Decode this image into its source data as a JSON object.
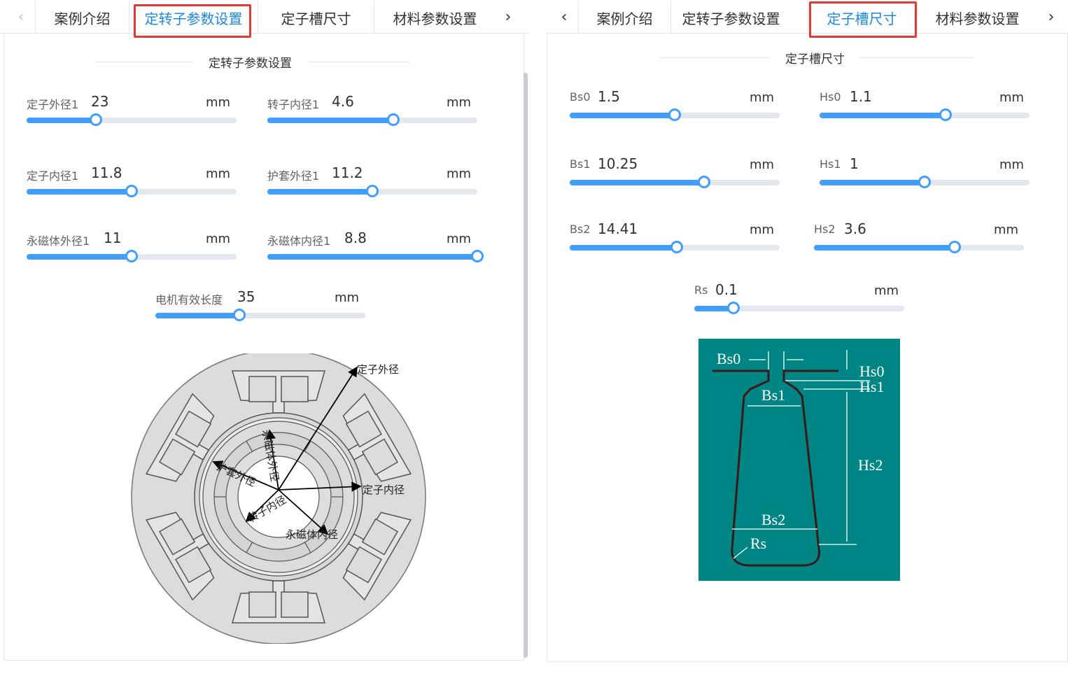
{
  "colors": {
    "accent": "#409eff",
    "highlight": "#e53935",
    "slot_bg": "#008585"
  },
  "left": {
    "tabs": [
      {
        "label": "案例介绍"
      },
      {
        "label": "定转子参数设置"
      },
      {
        "label": "定子槽尺寸"
      },
      {
        "label": "材料参数设置"
      }
    ],
    "active_tab": "定转子参数设置",
    "section_title": "定转子参数设置",
    "params": [
      {
        "label": "定子外径1",
        "value": "23",
        "unit": "mm",
        "fraction": 0.33
      },
      {
        "label": "转子内径1",
        "value": "4.6",
        "unit": "mm",
        "fraction": 0.6
      },
      {
        "label": "定子内径1",
        "value": "11.8",
        "unit": "mm",
        "fraction": 0.5
      },
      {
        "label": "护套外径1",
        "value": "11.2",
        "unit": "mm",
        "fraction": 0.5
      },
      {
        "label": "永磁体外径1",
        "value": "11",
        "unit": "mm",
        "fraction": 0.5
      },
      {
        "label": "永磁体内径1",
        "value": "8.8",
        "unit": "mm",
        "fraction": 1.0
      },
      {
        "label": "电机有效长度",
        "value": "35",
        "unit": "mm",
        "fraction": 0.4
      }
    ],
    "diagram_labels": {
      "stator_outer": "定子外径",
      "magnet_outer": "永磁体外径",
      "sleeve_outer": "护套外径",
      "stator_inner": "定子内径",
      "rotor_inner": "转子内径",
      "magnet_inner": "永磁体内径"
    }
  },
  "right": {
    "tabs": [
      {
        "label": "案例介绍"
      },
      {
        "label": "定转子参数设置"
      },
      {
        "label": "定子槽尺寸"
      },
      {
        "label": "材料参数设置"
      }
    ],
    "active_tab": "定子槽尺寸",
    "section_title": "定子槽尺寸",
    "params": [
      {
        "label": "Bs0",
        "value": "1.5",
        "unit": "mm",
        "fraction": 0.5
      },
      {
        "label": "Hs0",
        "value": "1.1",
        "unit": "mm",
        "fraction": 0.6
      },
      {
        "label": "Bs1",
        "value": "10.25",
        "unit": "mm",
        "fraction": 0.64
      },
      {
        "label": "Hs1",
        "value": "1",
        "unit": "mm",
        "fraction": 0.5
      },
      {
        "label": "Bs2",
        "value": "14.41",
        "unit": "mm",
        "fraction": 0.51
      },
      {
        "label": "Hs2",
        "value": "3.6",
        "unit": "mm",
        "fraction": 0.67
      },
      {
        "label": "Rs",
        "value": "0.1",
        "unit": "mm",
        "fraction": 0.185
      }
    ],
    "diagram_labels": {
      "bs0": "Bs0",
      "hs0": "Hs0",
      "hs1": "Hs1",
      "bs1": "Bs1",
      "hs2": "Hs2",
      "bs2": "Bs2",
      "rs": "Rs"
    }
  },
  "icons": {
    "prev": "chevron-left-icon",
    "next": "chevron-right-icon"
  }
}
